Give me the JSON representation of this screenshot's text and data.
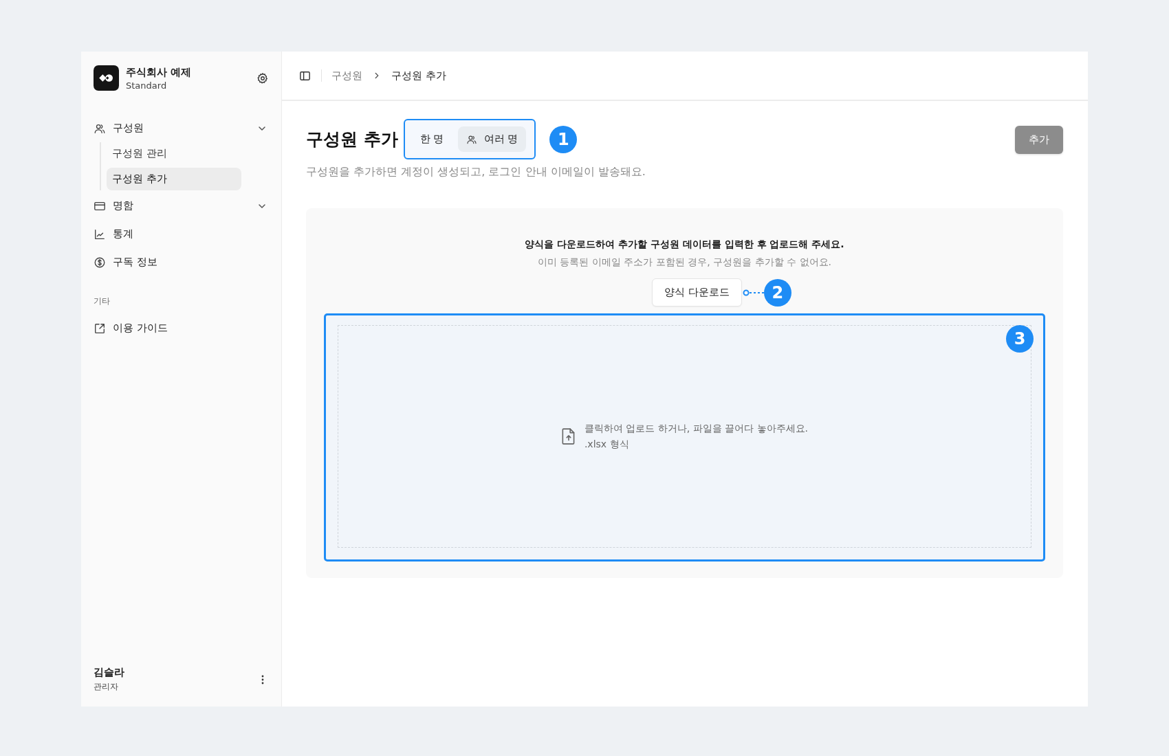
{
  "sidebar": {
    "org": {
      "name": "주식회사 예제",
      "plan": "Standard"
    },
    "items": [
      {
        "kind": "group",
        "label": "구성원",
        "children": [
          {
            "label": "구성원 관리",
            "selected": false
          },
          {
            "label": "구성원 추가",
            "selected": true
          }
        ]
      },
      {
        "kind": "group",
        "label": "명함"
      },
      {
        "kind": "link",
        "label": "통계"
      },
      {
        "kind": "link",
        "label": "구독 정보"
      }
    ],
    "section_title": "기타",
    "extra_items": [
      {
        "label": "이용 가이드"
      }
    ],
    "user": {
      "name": "김슬라",
      "role": "관리자"
    }
  },
  "breadcrumb": [
    {
      "label": "구성원",
      "current": false
    },
    {
      "label": "구성원 추가",
      "current": true
    }
  ],
  "page": {
    "title": "구성원 추가",
    "subtitle": "구성원을 추가하면 계정이 생성되고, 로그인 안내 이메일이 발송돼요.",
    "mode_tabs": [
      {
        "label": "한 명",
        "icon": false,
        "selected": false
      },
      {
        "label": "여러 명",
        "icon": true,
        "selected": true
      }
    ],
    "add_button": {
      "label": "추가",
      "disabled": true
    }
  },
  "upload": {
    "instruction": "양식을 다운로드하여 추가할 구성원 데이터를 입력한 후 업로드해 주세요.",
    "note": "이미 등록된 이메일 주소가 포함된 경우, 구성원을 추가할 수 없어요.",
    "download_button": "양식 다운로드",
    "drop_text": "클릭하여 업로드 하거나, 파일을 끌어다 놓아주세요.",
    "format": ".xlsx 형식"
  },
  "annotations": [
    "1",
    "2",
    "3"
  ]
}
